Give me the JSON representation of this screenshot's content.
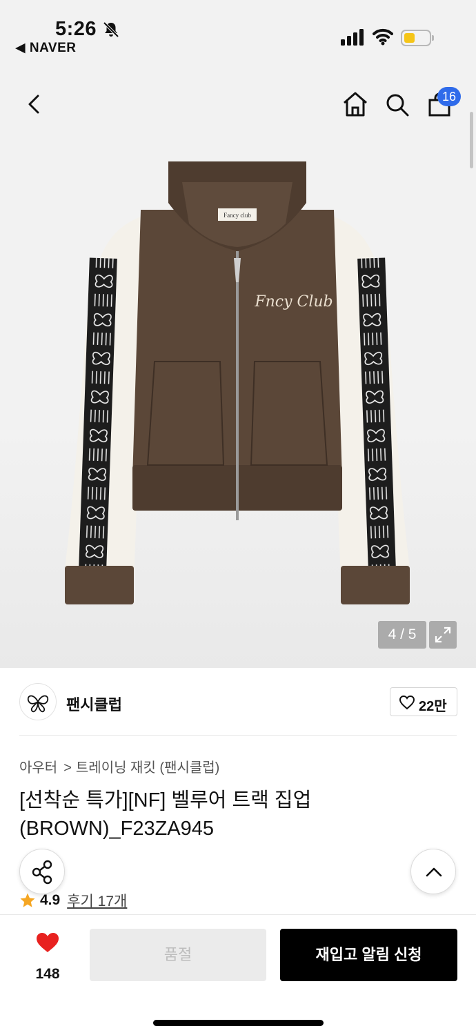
{
  "status_bar": {
    "time": "5:26",
    "back_app": "◀ NAVER",
    "battery_level": 0.45
  },
  "header": {
    "cart_count": "16",
    "icons": [
      "back-icon",
      "home-icon",
      "search-icon",
      "shopping-bag-icon"
    ]
  },
  "gallery": {
    "pager": "4 / 5",
    "jacket_label": "Fancy club",
    "jacket_embroidery": "Fncy Club"
  },
  "brand": {
    "name": "팬시클럽",
    "likes": "22만"
  },
  "breadcrumb": {
    "items": [
      "아우터",
      "트레이닝 재킷 (팬시클럽)"
    ],
    "separator": ">"
  },
  "product": {
    "title": "[선착순 특가][NF] 벨루어 트랙 집업 (BROWN)_F23ZA945",
    "rating": "4.9",
    "reviews": "후기 17개"
  },
  "bottom_bar": {
    "wish_count": "148",
    "soldout_label": "품절",
    "restock_label": "재입고 알림 신청"
  },
  "colors": {
    "accent_blue": "#2f6bea",
    "heart_red": "#e8211f",
    "star_orange": "#f5a623",
    "jacket_brown": "#5b4738"
  }
}
